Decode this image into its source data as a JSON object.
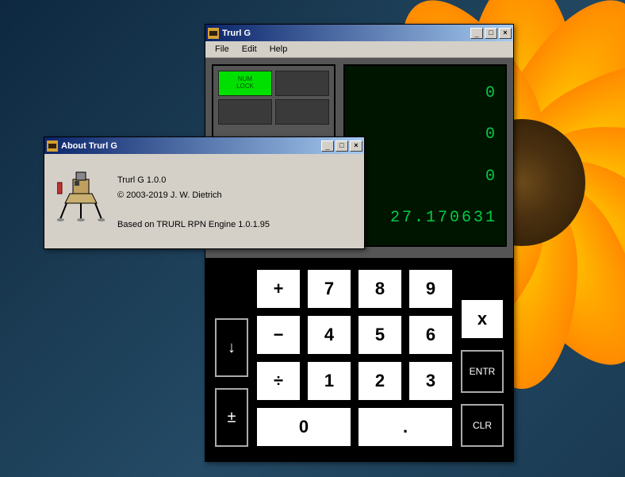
{
  "desktop": {
    "flower_colors": [
      "#ffcc00",
      "#ffa500",
      "#ff6600"
    ]
  },
  "main_window": {
    "title": "Trurl G",
    "menu": {
      "file": "File",
      "edit": "Edit",
      "help": "Help"
    },
    "controls": {
      "min": "_",
      "max": "□",
      "close": "×"
    },
    "indicators": {
      "numlock": {
        "label": "NUM\nLOCK",
        "on": true
      }
    },
    "lcd": {
      "stack": [
        "0",
        "0",
        "0"
      ],
      "x": "27.170631"
    },
    "keys": {
      "plus": "+",
      "minus": "−",
      "times": "x",
      "divide": "÷",
      "d0": "0",
      "d1": "1",
      "d2": "2",
      "d3": "3",
      "d4": "4",
      "d5": "5",
      "d6": "6",
      "d7": "7",
      "d8": "8",
      "d9": "9",
      "dot": ".",
      "down": "↓",
      "plusminus": "±",
      "entr": "ENTR",
      "clr": "CLR"
    }
  },
  "about_window": {
    "title": "About Trurl G",
    "controls": {
      "min": "_",
      "max": "□",
      "close": "×"
    },
    "line1": "Trurl G 1.0.0",
    "line2": "© 2003-2019 J. W. Dietrich",
    "line3": "Based on TRURL RPN Engine 1.0.1.95"
  }
}
